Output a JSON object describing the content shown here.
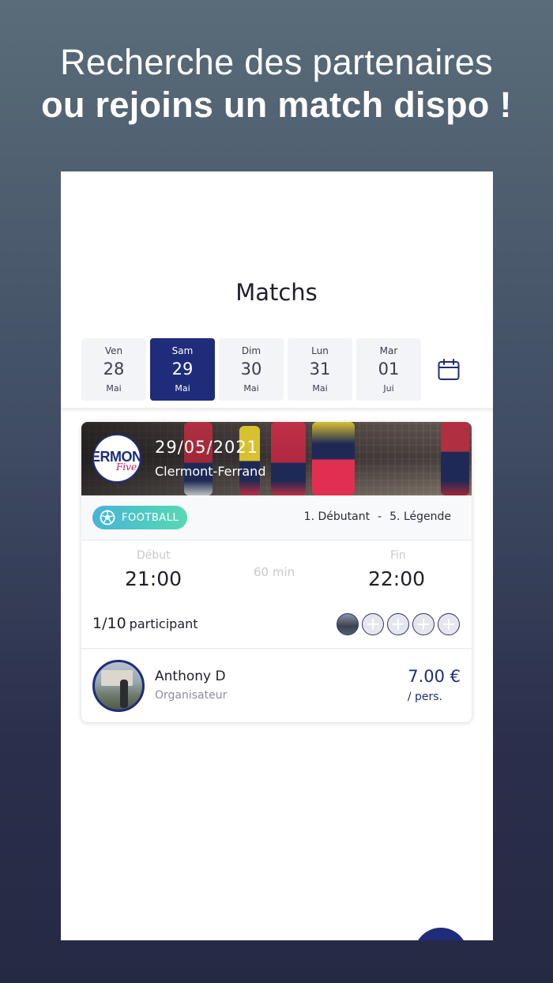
{
  "headline": {
    "line1": "Recherche des partenaires",
    "line2": "ou rejoins un match dispo !"
  },
  "page": {
    "title": "Matchs"
  },
  "dates": [
    {
      "dow": "Ven",
      "day": "28",
      "month": "Mai",
      "selected": false
    },
    {
      "dow": "Sam",
      "day": "29",
      "month": "Mai",
      "selected": true
    },
    {
      "dow": "Dim",
      "day": "30",
      "month": "Mai",
      "selected": false
    },
    {
      "dow": "Lun",
      "day": "31",
      "month": "Mai",
      "selected": false
    },
    {
      "dow": "Mar",
      "day": "01",
      "month": "Jui",
      "selected": false
    }
  ],
  "calendar_icon": "calendar-icon",
  "match": {
    "club_logo": "ERMON five",
    "date": "29/05/2021",
    "city": "Clermont-Ferrand",
    "sport": "FOOTBALL",
    "level_min": "1. Débutant",
    "level_sep": "-",
    "level_max": "5. Légende",
    "start_label": "Début",
    "start_time": "21:00",
    "duration": "60 min",
    "end_label": "Fin",
    "end_time": "22:00",
    "participants_count": "1/10",
    "participants_word": "participant",
    "slots_total": 5,
    "slots_filled": 1,
    "organizer_name": "Anthony D",
    "organizer_role": "Organisateur",
    "price": "7.00 €",
    "price_unit": "/ pers."
  },
  "colors": {
    "primary": "#1f2c7a",
    "badge_from": "#46b4d6",
    "badge_to": "#58d9b2",
    "chip_bg": "#f3f4f8"
  }
}
